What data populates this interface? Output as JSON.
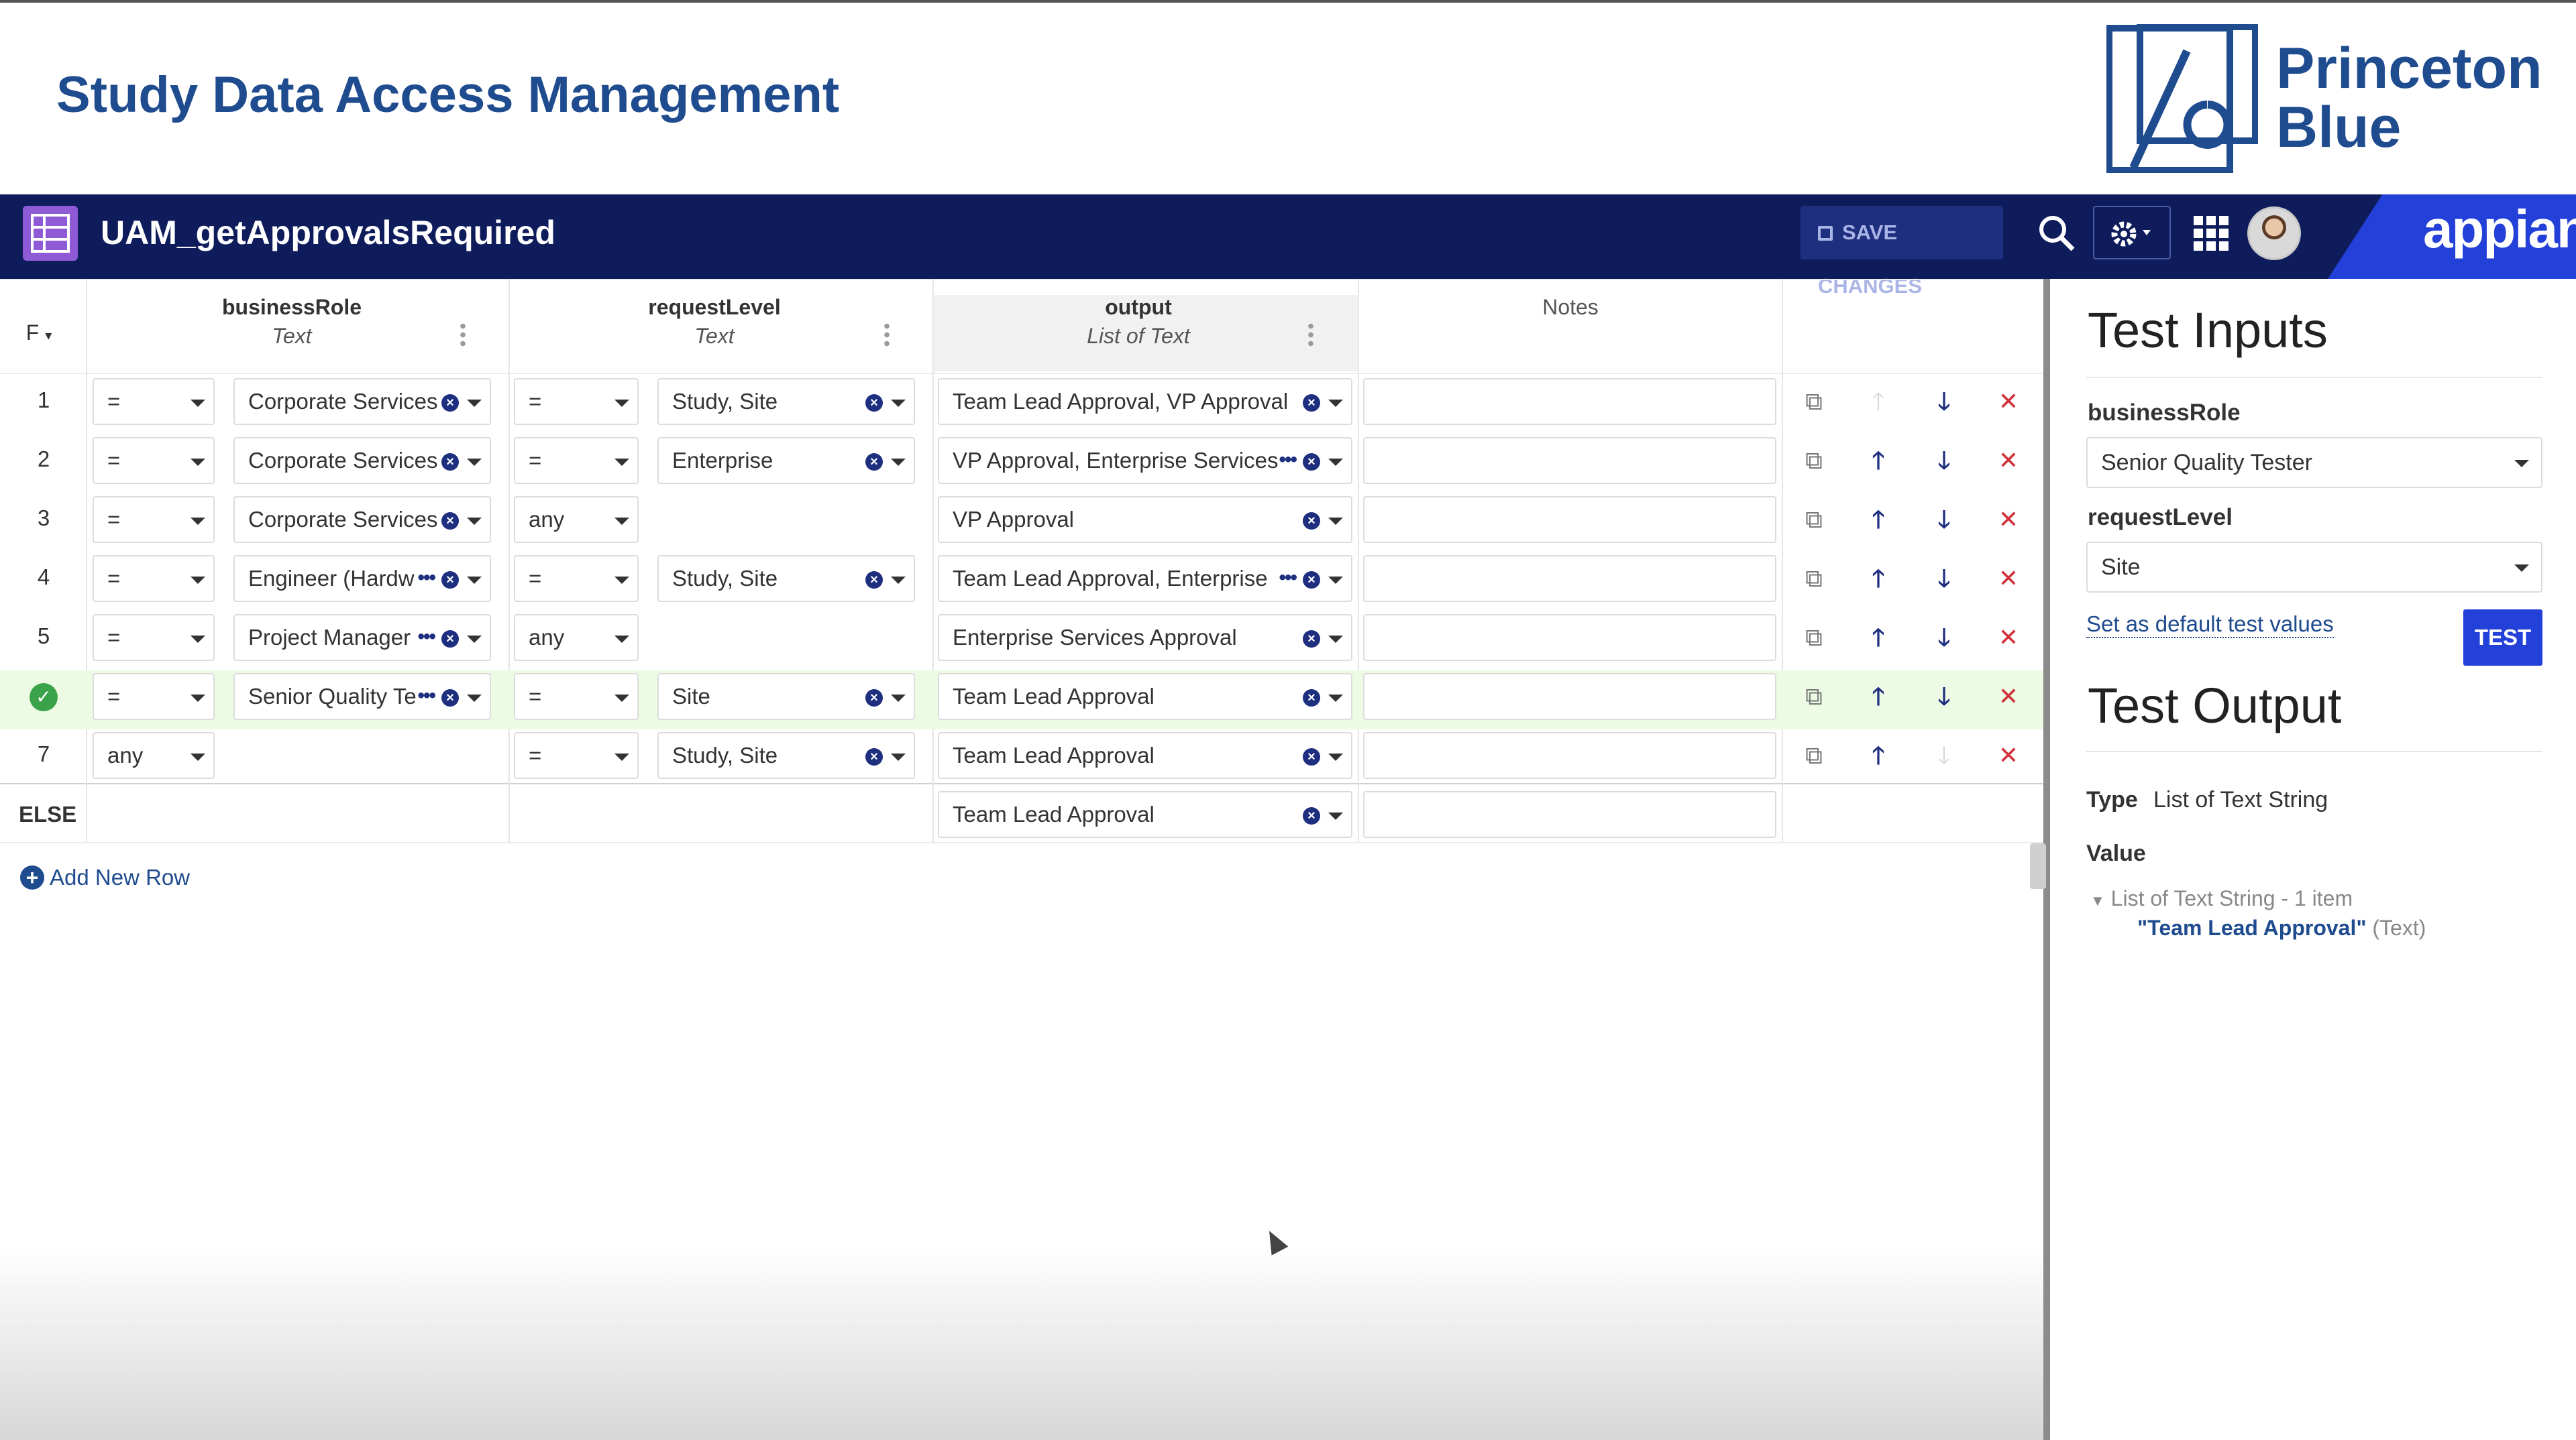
{
  "banner": {
    "title": "Study Data Access Management",
    "logo_line1": "Princeton",
    "logo_line2": "Blue"
  },
  "navbar": {
    "title": "UAM_getApprovalsRequired",
    "save_label": "SAVE CHANGES",
    "brand": "appian"
  },
  "grid": {
    "hit_policy": "F",
    "columns": [
      {
        "name": "businessRole",
        "type": "Text"
      },
      {
        "name": "requestLevel",
        "type": "Text"
      },
      {
        "name": "output",
        "type": "List of Text"
      },
      {
        "name": "Notes"
      }
    ],
    "rows": [
      {
        "num": "1",
        "op1": "=",
        "role": "Corporate Services",
        "op2": "=",
        "level": "Study, Site",
        "output": "Team Lead Approval, VP Approval"
      },
      {
        "num": "2",
        "op1": "=",
        "role": "Corporate Services",
        "op2": "=",
        "level": "Enterprise",
        "output": "VP Approval, Enterprise Services"
      },
      {
        "num": "3",
        "op1": "=",
        "role": "Corporate Services",
        "op2": "any",
        "level": "",
        "output": "VP Approval"
      },
      {
        "num": "4",
        "op1": "=",
        "role": "Engineer (Hardw",
        "op2": "=",
        "level": "Study, Site",
        "output": "Team Lead Approval, Enterprise"
      },
      {
        "num": "5",
        "op1": "=",
        "role": "Project Manager",
        "op2": "any",
        "level": "",
        "output": "Enterprise Services Approval"
      },
      {
        "num": "",
        "op1": "=",
        "role": "Senior Quality Te",
        "op2": "=",
        "level": "Site",
        "output": "Team Lead Approval"
      },
      {
        "num": "7",
        "op1": "any",
        "role": "",
        "op2": "=",
        "level": "Study, Site",
        "output": "Team Lead Approval"
      }
    ],
    "else_label": "ELSE",
    "else_output": "Team Lead Approval",
    "add_row_label": "Add New Row"
  },
  "panel": {
    "inputs_title": "Test Inputs",
    "business_role_label": "businessRole",
    "business_role_value": "Senior Quality Tester",
    "request_level_label": "requestLevel",
    "request_level_value": "Site",
    "default_link": "Set as default test values",
    "test_button": "TEST",
    "output_title": "Test Output",
    "type_label": "Type",
    "type_value": "List of Text String",
    "value_label": "Value",
    "tree_summary": "List of Text String - 1 item",
    "tree_item": "\"Team Lead Approval\"",
    "tree_item_type": "(Text)"
  },
  "colors": {
    "navbar": "#0f1c5c",
    "brand_blue": "#2340d9",
    "title_blue": "#1f4b8f",
    "delete_red": "#d0303a",
    "match_green": "#3aa34a"
  }
}
